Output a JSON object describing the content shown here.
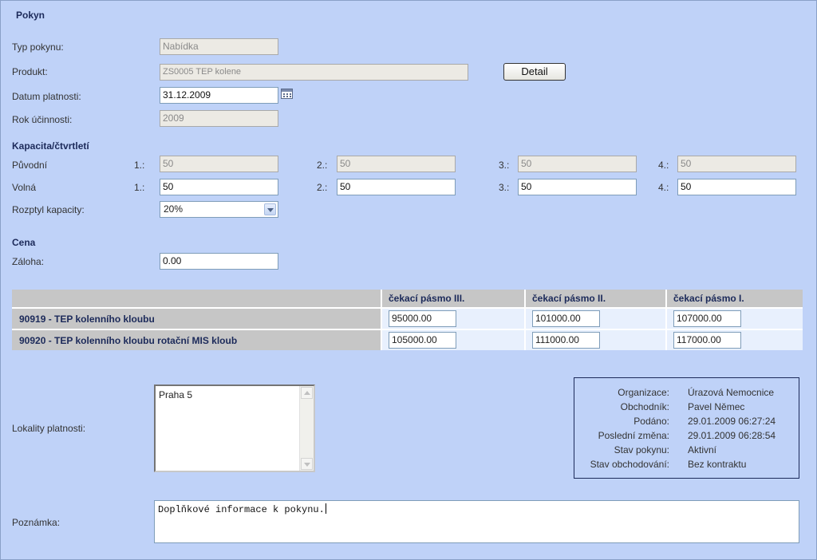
{
  "title": "Pokyn",
  "form": {
    "typ_pokynu": {
      "label": "Typ pokynu:",
      "value": "Nabídka"
    },
    "produkt": {
      "label": "Produkt:",
      "value": "ZS0005 TEP kolene"
    },
    "detail_button": "Detail",
    "datum_platnosti": {
      "label": "Datum platnosti:",
      "value": "31.12.2009"
    },
    "rok_ucinnosti": {
      "label": "Rok účinnosti:",
      "value": "2009"
    }
  },
  "kapacita": {
    "heading": "Kapacita/čtvrtletí",
    "quarter_labels": [
      "1.:",
      "2.:",
      "3.:",
      "4.:"
    ],
    "puvodni": {
      "label": "Původní",
      "values": [
        "50",
        "50",
        "50",
        "50"
      ]
    },
    "volna": {
      "label": "Volná",
      "values": [
        "50",
        "50",
        "50",
        "50"
      ]
    },
    "rozptyl": {
      "label": "Rozptyl kapacity:",
      "value": "20%"
    }
  },
  "cena": {
    "heading": "Cena",
    "zaloha": {
      "label": "Záloha:",
      "value": "0.00"
    }
  },
  "price_table": {
    "columns": [
      "",
      "čekací pásmo III.",
      "čekací pásmo II.",
      "čekací pásmo I."
    ],
    "rows": [
      {
        "name": "90919 - TEP kolenního kloubu",
        "values": [
          "95000.00",
          "101000.00",
          "107000.00"
        ]
      },
      {
        "name": "90920 - TEP kolenního kloubu rotační MIS kloub",
        "values": [
          "105000.00",
          "111000.00",
          "117000.00"
        ]
      }
    ]
  },
  "lokality": {
    "label": "Lokality platnosti:",
    "items": [
      "Praha 5"
    ]
  },
  "info": {
    "rows": [
      {
        "key": "Organizace:",
        "value": "Úrazová Nemocnice"
      },
      {
        "key": "Obchodník:",
        "value": "Pavel Němec"
      },
      {
        "key": "Podáno:",
        "value": "29.01.2009 06:27:24"
      },
      {
        "key": "Poslední změna:",
        "value": "29.01.2009 06:28:54"
      },
      {
        "key": "Stav pokynu:",
        "value": "Aktivní"
      },
      {
        "key": "Stav obchodování:",
        "value": "Bez kontraktu"
      }
    ]
  },
  "poznamka": {
    "label": "Poznámka:",
    "value": "Doplňkové informace k pokynu."
  }
}
